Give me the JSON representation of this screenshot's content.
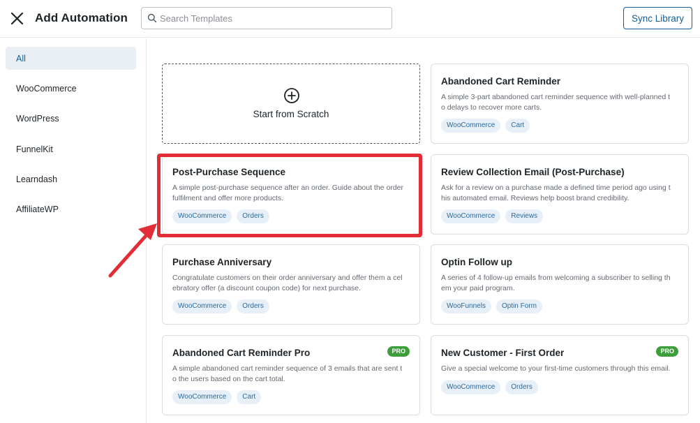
{
  "header": {
    "title": "Add Automation",
    "search_placeholder": "Search Templates",
    "sync_label": "Sync Library"
  },
  "sidebar": {
    "items": [
      {
        "label": "All",
        "active": true
      },
      {
        "label": "WooCommerce"
      },
      {
        "label": "WordPress"
      },
      {
        "label": "FunnelKit"
      },
      {
        "label": "Learndash"
      },
      {
        "label": "AffiliateWP"
      }
    ]
  },
  "scratch": {
    "label": "Start from Scratch",
    "icon": "plus-circle-icon"
  },
  "templates": [
    {
      "title": "Abandoned Cart Reminder",
      "desc_line1": "A simple 3-part abandoned cart reminder sequence with well-planned t",
      "desc_line2": "o delays to recover more carts.",
      "tags": [
        "WooCommerce",
        "Cart"
      ]
    },
    {
      "title": "Post-Purchase Sequence",
      "desc_line1": "A simple post-purchase sequence after an order. Guide about the order",
      "desc_line2": "fulfilment and offer more products.",
      "tags": [
        "WooCommerce",
        "Orders"
      ],
      "highlighted": true
    },
    {
      "title": "Review Collection Email (Post-Purchase)",
      "desc_line1": "Ask for a review on a purchase made a defined time period ago using t",
      "desc_line2": "his automated email. Reviews help boost brand credibility.",
      "tags": [
        "WooCommerce",
        "Reviews"
      ]
    },
    {
      "title": "Purchase Anniversary",
      "desc_line1": "Congratulate customers on their order anniversary and offer them a cel",
      "desc_line2": "ebratory offer (a discount coupon code) for next purchase.",
      "tags": [
        "WooCommerce",
        "Orders"
      ]
    },
    {
      "title": "Optin Follow up",
      "desc_line1": "A series of 4 follow-up emails from welcoming a subscriber to selling th",
      "desc_line2": "em your paid program.",
      "tags": [
        "WooFunnels",
        "Optin Form"
      ]
    },
    {
      "title": "Abandoned Cart Reminder Pro",
      "desc_line1": "A simple abandoned cart reminder sequence of 3 emails that are sent t",
      "desc_line2": "o the users based on the cart total.",
      "tags": [
        "WooCommerce",
        "Cart"
      ],
      "badge": "PRO"
    },
    {
      "title": "New Customer - First Order",
      "desc_line1": "Give a special welcome to your first-time customers through this email.",
      "desc_line2": "",
      "tags": [
        "WooCommerce",
        "Orders"
      ],
      "badge": "PRO"
    }
  ],
  "colors": {
    "accent": "#135e96",
    "highlight": "#e22d36",
    "pro_badge": "#3c9f3c",
    "tag_bg": "#e7f0f8",
    "active_bg": "#e9eff5"
  }
}
